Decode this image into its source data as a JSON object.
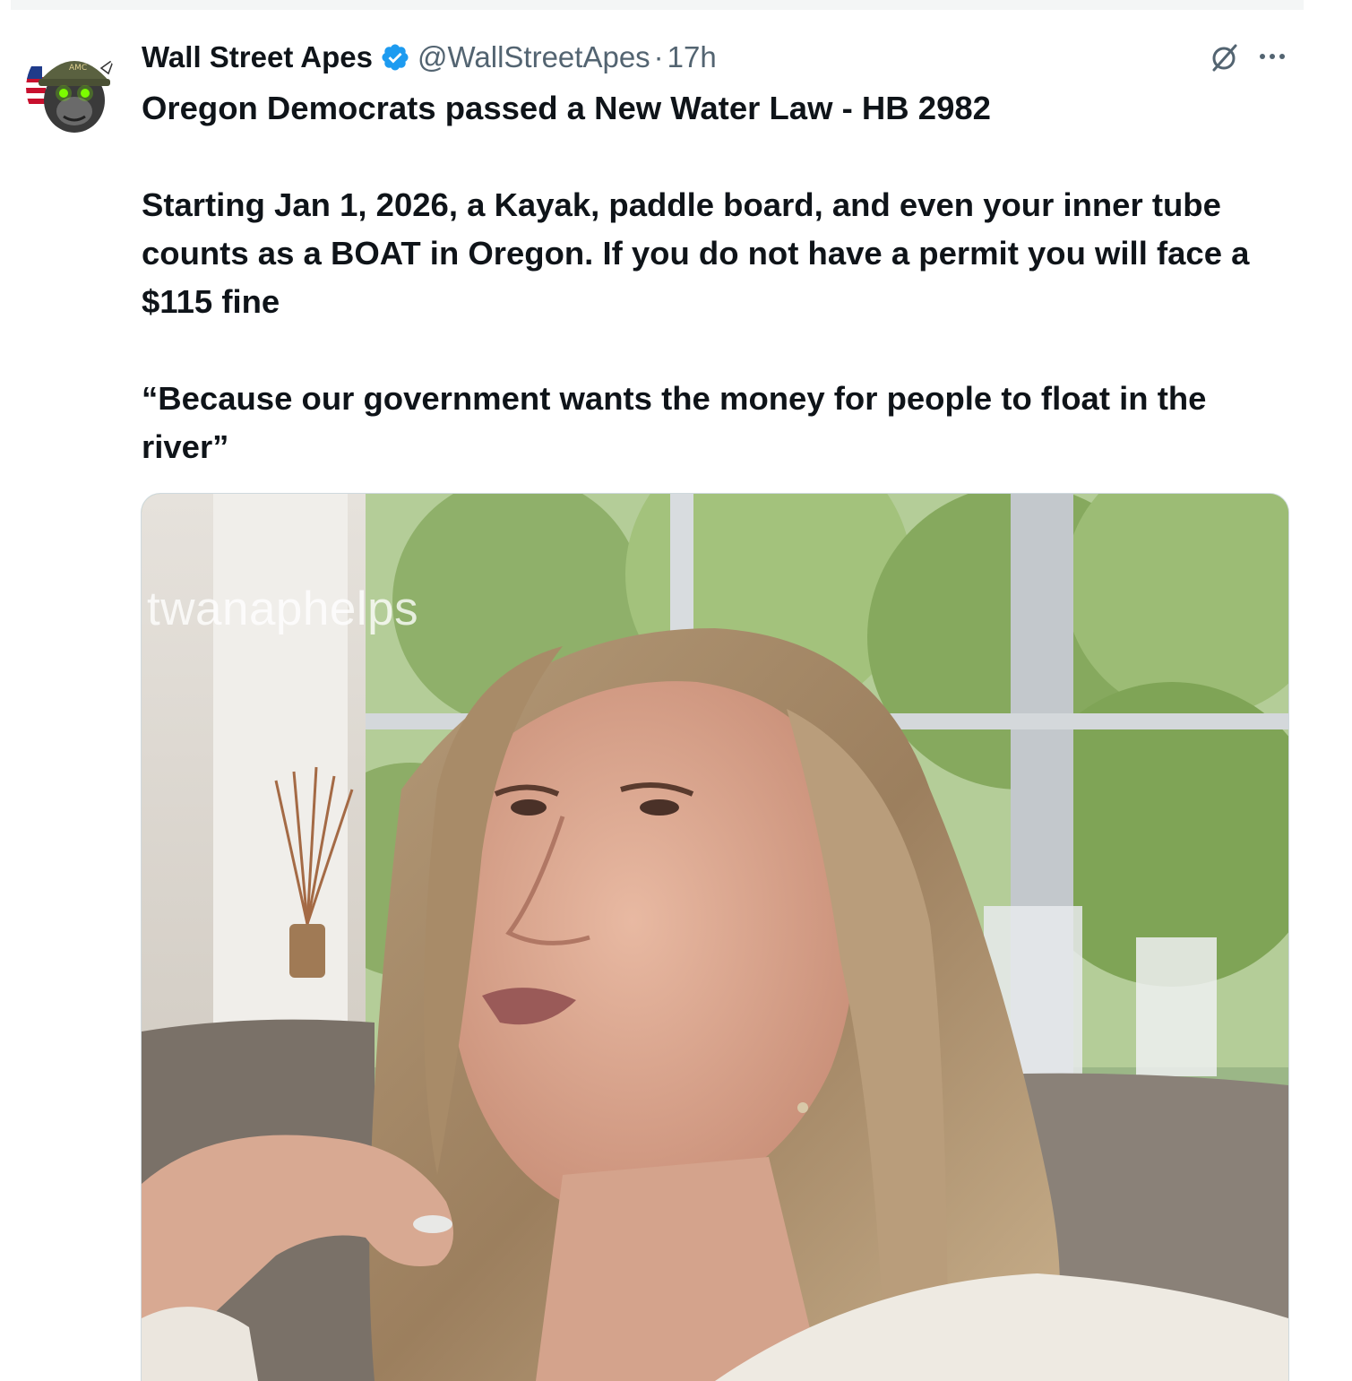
{
  "author": {
    "name": "Wall Street Apes",
    "handle": "@WallStreetApes",
    "separator": "·",
    "time": "17h",
    "verified": true,
    "avatar_icon": "ape-helmet-avatar"
  },
  "actions": {
    "grok_icon": "grok-icon",
    "more_icon": "more-icon",
    "more_label": "···"
  },
  "tweet": {
    "headline": "Oregon Democrats passed a New Water Law - HB 2982",
    "body": "Starting Jan 1, 2026, a Kayak, paddle board, and even your inner tube counts as a BOAT in Oregon. If you do not have a permit you will face a $115 fine",
    "quote": "“Because our government wants the money for people to float in the river”"
  },
  "media": {
    "type": "video",
    "watermark": "twanaphelps"
  },
  "colors": {
    "text_primary": "#0f1419",
    "text_secondary": "#536471",
    "verified_blue": "#1d9bf0"
  }
}
